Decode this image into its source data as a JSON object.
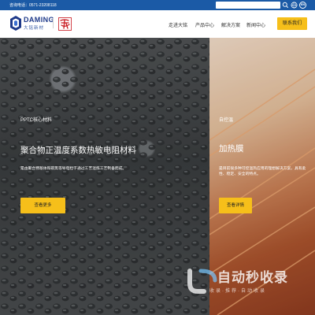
{
  "topbar": {
    "phone": "咨询电话：0571-23208118",
    "lang": "EN",
    "search_placeholder": ""
  },
  "header": {
    "logo_en": "DAMING",
    "logo_cn": "大铭新材",
    "nav": [
      "走进大铭",
      "产品中心",
      "解决方案",
      "新闻中心"
    ],
    "contact_label": "联系我们"
  },
  "hero": {
    "left": {
      "tag": "PPTC核心材料",
      "title": "聚合物正温度系数热敏电阻材料",
      "description": "是由聚合物基体和碳黑等导电粒子通过工艺混炼工艺制备而成。",
      "more_label": "查看更多"
    },
    "right": {
      "tag": "自控温",
      "title": "加热膜",
      "description": "是目前很多种可控温热应用的理想解决方案，具有柔性、稳定、安全的特点。",
      "more_label": "查看详情"
    }
  },
  "watermark": {
    "text": "自动秒收录",
    "subtext": "收录·推荐·自动收录"
  },
  "colors": {
    "brand_blue": "#1b5aa6",
    "accent_yellow": "#f6bf1a"
  }
}
